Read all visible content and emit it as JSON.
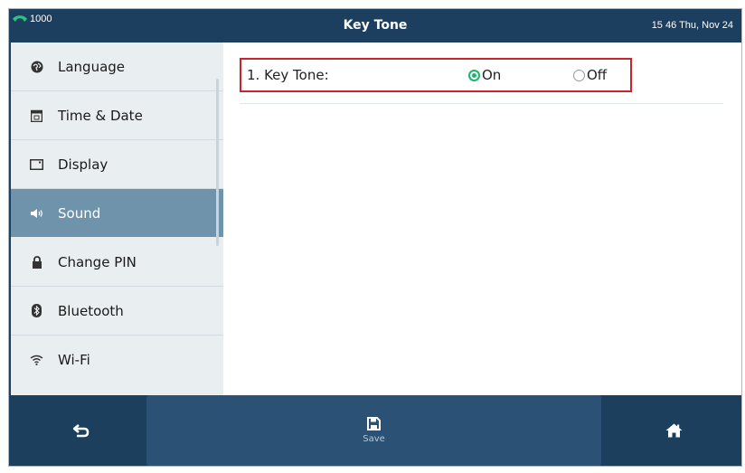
{
  "status_bar": {
    "line_number": "1000",
    "title": "Key Tone",
    "datetime": "15 46 Thu, Nov 24"
  },
  "sidebar": {
    "items": [
      {
        "label": "Language",
        "icon": "globe-icon"
      },
      {
        "label": "Time & Date",
        "icon": "calendar-icon"
      },
      {
        "label": "Display",
        "icon": "display-icon"
      },
      {
        "label": "Sound",
        "icon": "speaker-icon",
        "active": true
      },
      {
        "label": "Change PIN",
        "icon": "lock-icon"
      },
      {
        "label": "Bluetooth",
        "icon": "bluetooth-icon"
      },
      {
        "label": "Wi-Fi",
        "icon": "wifi-icon"
      }
    ]
  },
  "setting": {
    "label": "1. Key Tone:",
    "options": [
      {
        "label": "On",
        "selected": true
      },
      {
        "label": "Off",
        "selected": false
      }
    ]
  },
  "softkeys": {
    "back_icon": "back-icon",
    "save_label": "Save",
    "home_icon": "home-icon"
  },
  "colors": {
    "header": "#1d3f5f",
    "sidebar_active": "#6f93ab",
    "radio_selected": "#1bb56f",
    "highlight_border": "#c9242b"
  }
}
